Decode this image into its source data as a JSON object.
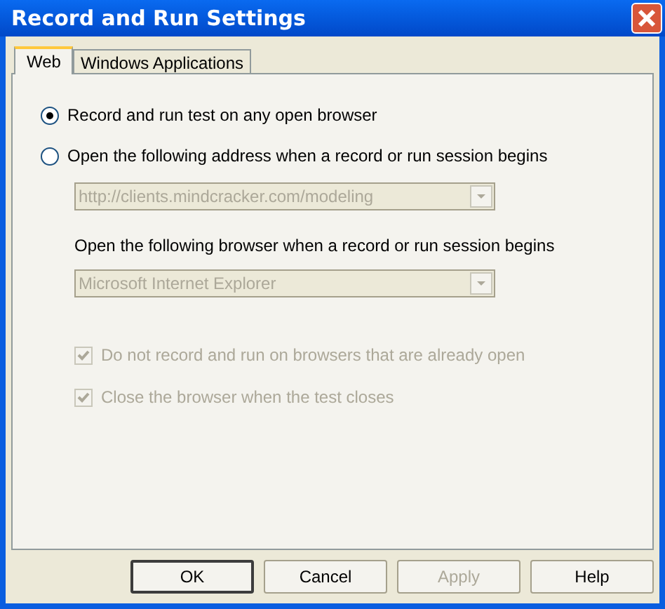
{
  "window": {
    "title": "Record and Run Settings"
  },
  "tabs": [
    {
      "label": "Web",
      "selected": true
    },
    {
      "label": "Windows Applications",
      "selected": false
    }
  ],
  "radios": [
    {
      "label": "Record and run test on any open browser",
      "selected": true
    },
    {
      "label": "Open the following address when a record or run session begins",
      "selected": false
    }
  ],
  "address_combo": {
    "value": "http://clients.mindcracker.com/modeling",
    "disabled": true
  },
  "browser_label": "Open the following browser when a record or run session begins",
  "browser_combo": {
    "value": "Microsoft Internet Explorer",
    "disabled": true
  },
  "checkboxes": [
    {
      "label": "Do not record and run on browsers that are already open",
      "checked": true,
      "disabled": true
    },
    {
      "label": "Close the browser when the test closes",
      "checked": true,
      "disabled": true
    }
  ],
  "buttons": [
    {
      "label": "OK",
      "default": true,
      "disabled": false
    },
    {
      "label": "Cancel",
      "default": false,
      "disabled": false
    },
    {
      "label": "Apply",
      "default": false,
      "disabled": true
    },
    {
      "label": "Help",
      "default": false,
      "disabled": false
    }
  ]
}
